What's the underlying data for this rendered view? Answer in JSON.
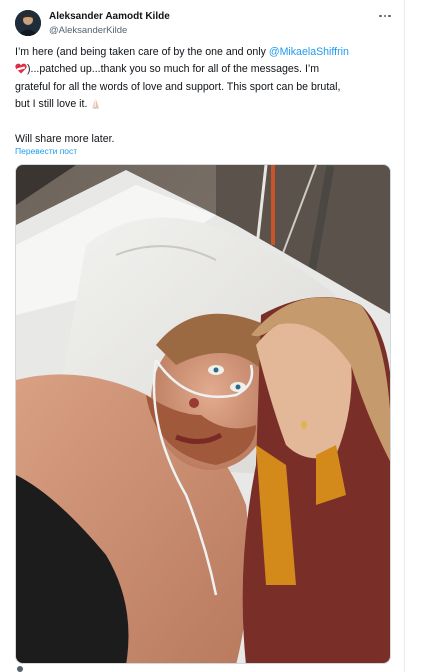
{
  "post": {
    "author_name": "Aleksander Aamodt Kilde",
    "author_handle": "@AleksanderKilde",
    "more_icon": "more-horizontal-icon",
    "text_line1_before": "I’m here (and being taken care of by the one and only ",
    "mention": "@MikaelaShiffrin",
    "text_line2": ")...patched up...thank you so much for all of the messages. I’m",
    "text_line3": "grateful  for all the words of love and support. This sport can be brutal,",
    "text_line4": "but I still love it.",
    "text_line5": "Will share more later.",
    "translate_link": "Перевести пост",
    "emojis": [
      "mending-heart-emoji",
      "folded-hands-emoji"
    ]
  },
  "colors": {
    "accent": "#1d9bf0",
    "text": "#0f1419",
    "secondary": "#536471",
    "border": "#cfd9de"
  }
}
